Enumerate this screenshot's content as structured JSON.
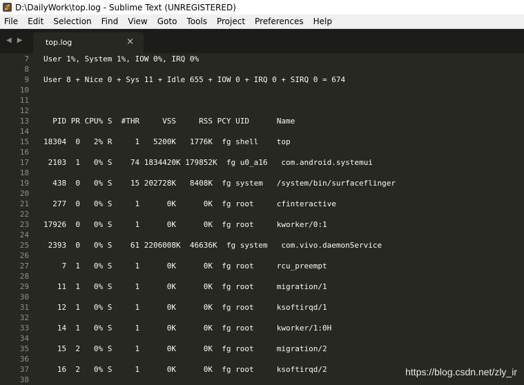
{
  "window": {
    "title": "D:\\DailyWork\\top.log - Sublime Text (UNREGISTERED)"
  },
  "menu": [
    "File",
    "Edit",
    "Selection",
    "Find",
    "View",
    "Goto",
    "Tools",
    "Project",
    "Preferences",
    "Help"
  ],
  "tabs": [
    {
      "label": "top.log",
      "close": "×"
    }
  ],
  "nav": {
    "back": "◀",
    "forward": "▶"
  },
  "editor": {
    "lines": [
      {
        "n": "7",
        "text": "User 1%, System 1%, IOW 0%, IRQ 0%"
      },
      {
        "n": "8",
        "text": ""
      },
      {
        "n": "9",
        "text": "User 8 + Nice 0 + Sys 11 + Idle 655 + IOW 0 + IRQ 0 + SIRQ 0 = 674"
      },
      {
        "n": "10",
        "text": ""
      },
      {
        "n": "11",
        "text": ""
      },
      {
        "n": "12",
        "text": ""
      },
      {
        "n": "13",
        "text": "  PID PR CPU% S  #THR     VSS     RSS PCY UID      Name"
      },
      {
        "n": "14",
        "text": ""
      },
      {
        "n": "15",
        "text": "18304  0   2% R     1   5200K   1776K  fg shell    top"
      },
      {
        "n": "16",
        "text": ""
      },
      {
        "n": "17",
        "text": " 2103  1   0% S    74 1834420K 179852K  fg u0_a16   com.android.systemui"
      },
      {
        "n": "18",
        "text": ""
      },
      {
        "n": "19",
        "text": "  438  0   0% S    15 202728K   8408K  fg system   /system/bin/surfaceflinger"
      },
      {
        "n": "20",
        "text": ""
      },
      {
        "n": "21",
        "text": "  277  0   0% S     1      0K      0K  fg root     cfinteractive"
      },
      {
        "n": "22",
        "text": ""
      },
      {
        "n": "23",
        "text": "17926  0   0% S     1      0K      0K  fg root     kworker/0:1"
      },
      {
        "n": "24",
        "text": ""
      },
      {
        "n": "25",
        "text": " 2393  0   0% S    61 2206008K  46636K  fg system   com.vivo.daemonService"
      },
      {
        "n": "26",
        "text": ""
      },
      {
        "n": "27",
        "text": "    7  1   0% S     1      0K      0K  fg root     rcu_preempt"
      },
      {
        "n": "28",
        "text": ""
      },
      {
        "n": "29",
        "text": "   11  1   0% S     1      0K      0K  fg root     migration/1"
      },
      {
        "n": "30",
        "text": ""
      },
      {
        "n": "31",
        "text": "   12  1   0% S     1      0K      0K  fg root     ksoftirqd/1"
      },
      {
        "n": "32",
        "text": ""
      },
      {
        "n": "33",
        "text": "   14  1   0% S     1      0K      0K  fg root     kworker/1:0H"
      },
      {
        "n": "34",
        "text": ""
      },
      {
        "n": "35",
        "text": "   15  2   0% S     1      0K      0K  fg root     migration/2"
      },
      {
        "n": "36",
        "text": ""
      },
      {
        "n": "37",
        "text": "   16  2   0% S     1      0K      0K  fg root     ksoftirqd/2"
      },
      {
        "n": "38",
        "text": ""
      }
    ]
  },
  "watermark": "https://blog.csdn.net/zly_ir",
  "colors": {
    "editor_bg": "#272822",
    "tabbar_bg": "#1c1d19",
    "text": "#f8f8f2",
    "gutter_text": "#8f908a"
  }
}
